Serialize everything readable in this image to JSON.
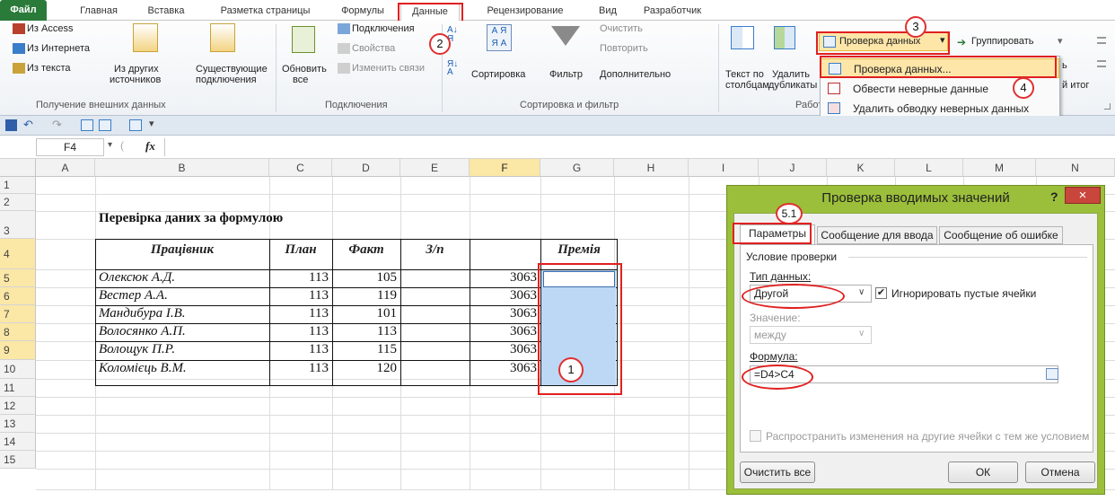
{
  "tabs": [
    "Файл",
    "Главная",
    "Вставка",
    "Разметка страницы",
    "Формулы",
    "Данные",
    "Рецензирование",
    "Вид",
    "Разработчик"
  ],
  "ribbon": {
    "ext": {
      "access": "Из Access",
      "web": "Из Интернета",
      "text": "Из текста",
      "other1": "Из других",
      "other2": "источников",
      "conn1": "Существующие",
      "conn2": "подключения",
      "group": "Получение внешних данных"
    },
    "conn": {
      "refresh1": "Обновить",
      "refresh2": "все",
      "connections": "Подключения",
      "props": "Свойства",
      "edit": "Изменить связи",
      "group": "Подключения"
    },
    "sort": {
      "sort": "Сортировка",
      "filter": "Фильтр",
      "clear": "Очистить",
      "reapply": "Повторить",
      "advanced": "Дополнительно",
      "group": "Сортировка и фильтр"
    },
    "tools": {
      "t2c1": "Текст по",
      "t2c2": "столбцам",
      "dup1": "Удалить",
      "dup2": "дубликаты",
      "group": "Работа с",
      "validation": "Проверка данных",
      "group_btn": "Группировать",
      "b1": "ь",
      "b2": "й итог"
    }
  },
  "menu": {
    "items": [
      "Проверка данных...",
      "Обвести неверные данные",
      "Удалить обводку неверных данных"
    ]
  },
  "namebox": "F4",
  "fx": "fx",
  "columns": [
    "A",
    "B",
    "C",
    "D",
    "E",
    "F",
    "G",
    "H",
    "I",
    "J",
    "K",
    "L",
    "M",
    "N"
  ],
  "rows": [
    "1",
    "2",
    "3",
    "4",
    "5",
    "6",
    "7",
    "8",
    "9",
    "10",
    "11",
    "12",
    "13",
    "14",
    "15"
  ],
  "sheet": {
    "title": "Перевірка даних за формулою",
    "headers": [
      "Працівник",
      "План",
      "Факт",
      "З/п",
      "Премія"
    ],
    "data": [
      [
        "Олексюк А.Д.",
        "113",
        "105",
        "3063"
      ],
      [
        "Вестер А.А.",
        "113",
        "119",
        "3063"
      ],
      [
        "Мандибура І.В.",
        "113",
        "101",
        "3063"
      ],
      [
        "Волосянко А.П.",
        "113",
        "113",
        "3063"
      ],
      [
        "Волощук П.Р.",
        "113",
        "115",
        "3063"
      ],
      [
        "Коломієць В.М.",
        "113",
        "120",
        "3063"
      ]
    ]
  },
  "dialog": {
    "title": "Проверка вводимых значений",
    "help": "?",
    "close": "×",
    "tabs": [
      "Параметры",
      "Сообщение для ввода",
      "Сообщение об ошибке"
    ],
    "section": "Условие проверки",
    "type_label": "Тип данных:",
    "type_value": "Другой",
    "ignore_blank": "Игнорировать пустые ячейки",
    "value_label": "Значение:",
    "value_value": "между",
    "formula_label": "Формула:",
    "formula_value": "=D4>C4",
    "propagate": "Распространить изменения на другие ячейки с тем же условием",
    "clear_all": "Очистить все",
    "ok": "ОК",
    "cancel": "Отмена"
  },
  "callouts": [
    "3",
    "2",
    "4",
    "5.1",
    "1"
  ]
}
